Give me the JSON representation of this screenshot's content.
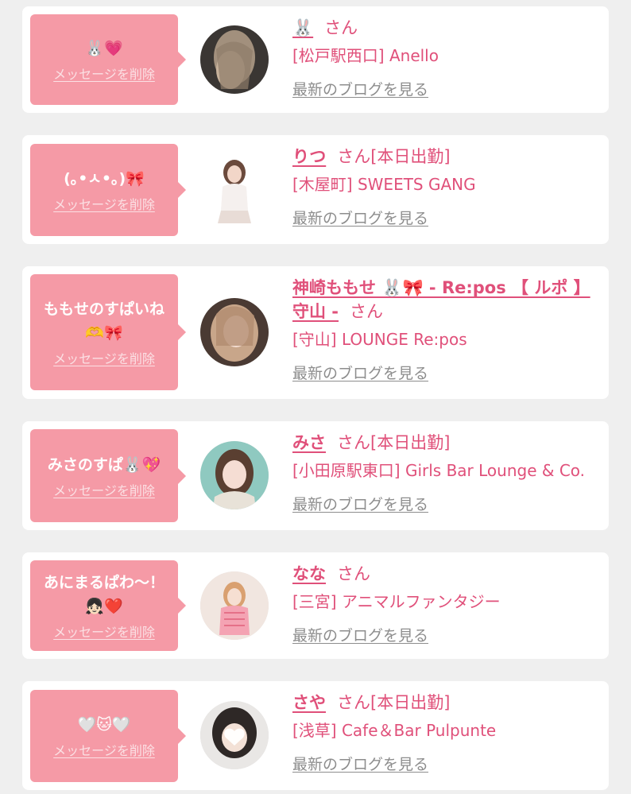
{
  "delete_label": "メッセージを削除",
  "blog_label": "最新のブログを見る",
  "san_label": "さん",
  "on_duty_label": "[本日出勤]",
  "cards": [
    {
      "message": "🐰💗",
      "name": "🐰",
      "on_duty": false,
      "shop": "[松戸駅西口] Anello"
    },
    {
      "message": "(｡•ㅅ•｡)🎀",
      "name": "りつ",
      "on_duty": true,
      "shop": "[木屋町] SWEETS GANG"
    },
    {
      "message": "ももせのすぱいね\n🫶🎀",
      "name": "神崎ももせ 🐰🎀 - Re:pos 【 ルポ 】 守山 -",
      "on_duty": false,
      "shop": "[守山] LOUNGE Re:pos"
    },
    {
      "message": "みさのすぱ🐰💖",
      "name": "みさ",
      "on_duty": true,
      "shop": "[小田原駅東口] Girls Bar Lounge & Co."
    },
    {
      "message": "あにまるぱわ〜！\n👧🏻❤️",
      "name": "なな",
      "on_duty": false,
      "shop": "[三宮] アニマルファンタジー"
    },
    {
      "message": "🤍🐱🤍",
      "name": "さや",
      "on_duty": true,
      "shop": "[浅草] Cafe＆Bar Pulpunte"
    }
  ]
}
